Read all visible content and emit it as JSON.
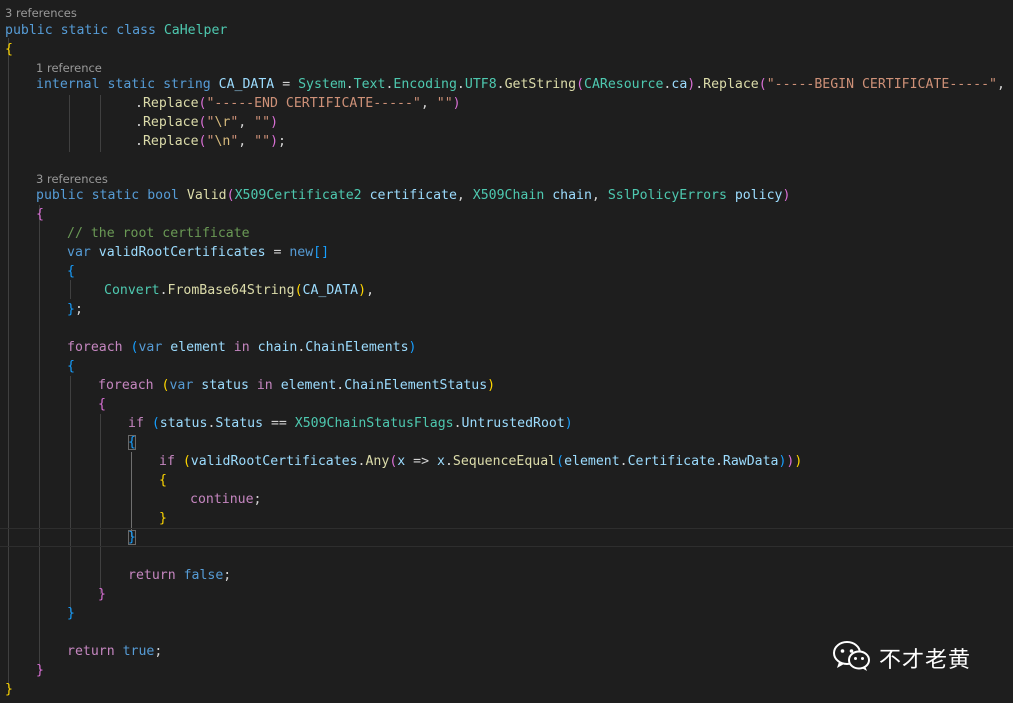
{
  "code_lens": {
    "class_refs": "3 references",
    "field_refs": "1 reference",
    "method_refs": "3 references"
  },
  "code": {
    "kw_public": "public",
    "kw_static": "static",
    "kw_class": "class",
    "kw_internal": "internal",
    "kw_string": "string",
    "kw_bool": "bool",
    "kw_var": "var",
    "kw_new": "new",
    "kw_in": "in",
    "kw_foreach": "foreach",
    "kw_if": "if",
    "kw_continue": "continue",
    "kw_return": "return",
    "kw_false": "false",
    "kw_true": "true",
    "class_name": "CaHelper",
    "field_name": "CA_DATA",
    "ns_system": "System",
    "ns_text": "Text",
    "ns_encoding": "Encoding",
    "prop_utf8": "UTF8",
    "fn_getstring": "GetString",
    "type_caresource": "CAResource",
    "prop_ca": "ca",
    "fn_replace": "Replace",
    "str_begin": "\"-----BEGIN CERTIFICATE-----\"",
    "str_end": "\"-----END CERTIFICATE-----\"",
    "str_empty": "\"\"",
    "str_quote": "\"",
    "esc_r": "\\r",
    "esc_n": "\\n",
    "method_name": "Valid",
    "type_cert": "X509Certificate2",
    "param_certificate": "certificate",
    "type_chain": "X509Chain",
    "param_chain": "chain",
    "type_policy": "SslPolicyErrors",
    "param_policy": "policy",
    "comment_root": "// the root certificate",
    "var_valid_roots": "validRootCertificates",
    "type_convert": "Convert",
    "fn_frombase64": "FromBase64String",
    "var_element": "element",
    "prop_chain_elements": "ChainElements",
    "var_status": "status",
    "prop_chain_element_status": "ChainElementStatus",
    "prop_status": "Status",
    "type_flags": "X509ChainStatusFlags",
    "enum_untrusted_root": "UntrustedRoot",
    "fn_any": "Any",
    "var_x": "x",
    "fn_sequence_equal": "SequenceEqual",
    "prop_certificate": "Certificate",
    "prop_raw_data": "RawData"
  },
  "watermark": {
    "text": "不才老黄",
    "icon": "wechat-icon"
  },
  "colors": {
    "background": "#1e1e1e",
    "keyword": "#569cd6",
    "control": "#c586c0",
    "type": "#4ec9b0",
    "method": "#dcdcaa",
    "variable": "#9cdcfe",
    "string": "#ce9178",
    "comment": "#6a9955"
  }
}
